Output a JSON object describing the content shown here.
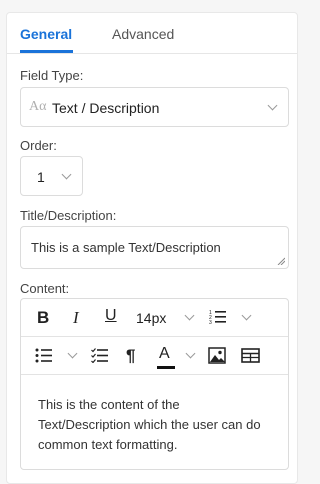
{
  "tabs": {
    "general": "General",
    "advanced": "Advanced"
  },
  "field_type": {
    "label": "Field Type:",
    "icon_text": "Aα",
    "value": "Text / Description"
  },
  "order": {
    "label": "Order:",
    "value": "1"
  },
  "title": {
    "label": "Title/Description:",
    "value": "This is a sample Text/Description"
  },
  "content": {
    "label": "Content:",
    "toolbar": {
      "bold": "B",
      "italic": "I",
      "underline": "U",
      "font_size": "14px",
      "paragraph": "¶",
      "font_color": "A"
    },
    "text": "This is the content of the Text/Description which the user can do common text formatting."
  },
  "colors": {
    "accent": "#1a73d9",
    "border": "#dcdcdc"
  }
}
